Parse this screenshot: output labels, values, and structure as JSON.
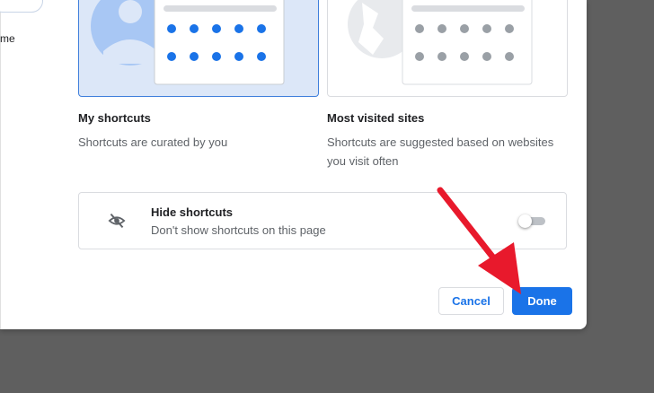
{
  "sidebar_fragment": {
    "text": "me"
  },
  "options": [
    {
      "title": "My shortcuts",
      "description": "Shortcuts are curated by you",
      "selected": true
    },
    {
      "title": "Most visited sites",
      "description": "Shortcuts are suggested based on websites you visit often",
      "selected": false
    }
  ],
  "hide_shortcuts": {
    "title": "Hide shortcuts",
    "subtitle": "Don't show shortcuts on this page",
    "icon": "eye-off-icon",
    "enabled": false
  },
  "buttons": {
    "cancel_label": "Cancel",
    "done_label": "Done"
  },
  "colors": {
    "accent": "#1a73e8",
    "selected_card_bg": "#dce7f8",
    "overlay": "#5f5f5f",
    "annotation_arrow": "#e8192c"
  }
}
